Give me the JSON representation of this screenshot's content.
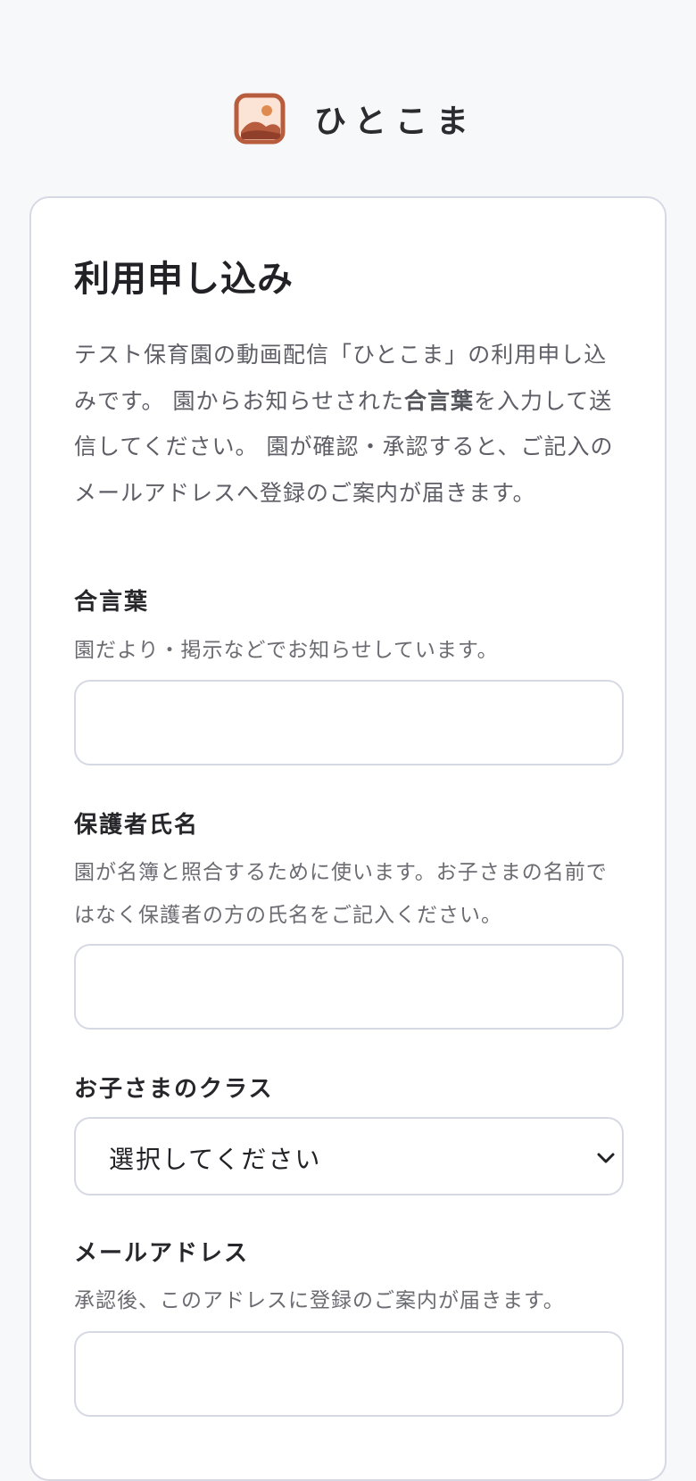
{
  "app": {
    "name": "ひとこま",
    "logo_icon": "picture-landscape-icon",
    "accent_color": "#b85c3e"
  },
  "form": {
    "title": "利用申し込み",
    "intro": {
      "before": "テスト保育園の動画配信「ひとこま」の利用申し込みです。 園からお知らせされた",
      "keyword": "合言葉",
      "after": "を入力して送信してください。 園が確認・承認すると、ご記入のメールアドレスへ登録のご案内が届きます。"
    },
    "passphrase": {
      "label": "合言葉",
      "hint": "園だより・掲示などでお知らせしています。",
      "value": ""
    },
    "guardian_name": {
      "label": "保護者氏名",
      "hint": "園が名簿と照合するために使います。お子さまの名前ではなく保護者の方の氏名をご記入ください。",
      "value": ""
    },
    "child_class": {
      "label": "お子さまのクラス",
      "selected": "選択してください",
      "icon": "chevron-down-icon"
    },
    "email": {
      "label": "メールアドレス",
      "hint": "承認後、このアドレスに登録のご案内が届きます。",
      "value": ""
    }
  }
}
